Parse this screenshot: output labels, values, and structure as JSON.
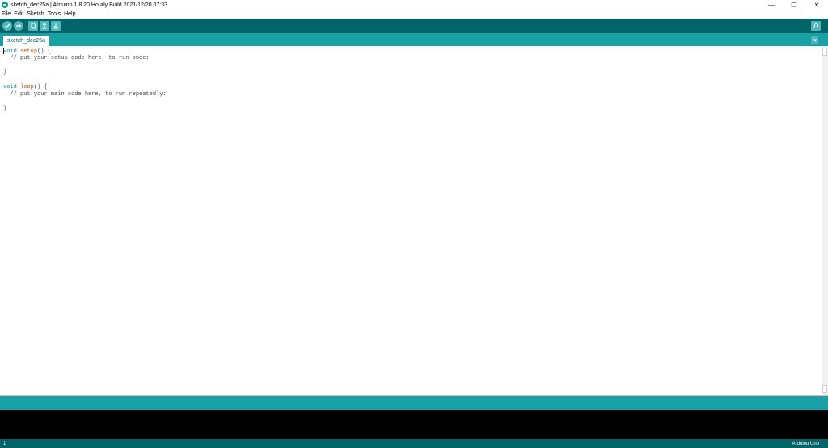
{
  "window": {
    "title": "sketch_dec25a | Arduino 1.8.20 Hourly Build 2021/12/20 07:33",
    "minimize_glyph": "—",
    "restore_glyph": "❐",
    "close_glyph": "✕"
  },
  "menu": {
    "items": [
      {
        "label": "File"
      },
      {
        "label": "Edit"
      },
      {
        "label": "Sketch"
      },
      {
        "label": "Tools"
      },
      {
        "label": "Help"
      }
    ]
  },
  "toolbar": {
    "buttons": [
      "verify-icon",
      "upload-icon",
      "new-icon",
      "open-icon",
      "save-icon"
    ],
    "serial_monitor_icon": "magnifier-icon"
  },
  "tabs": [
    {
      "label": "sketch_dec25a",
      "active": true
    }
  ],
  "editor": {
    "lines": [
      {
        "t1": "void",
        "t2": " ",
        "t3": "setup",
        "t4": "() {"
      },
      {
        "t1": "",
        "t2": "  // put your setup code here, to run once:",
        "t3": "",
        "t4": ""
      },
      {
        "t1": "",
        "t2": "",
        "t3": "",
        "t4": ""
      },
      {
        "t1": "",
        "t2": "}",
        "t3": "",
        "t4": ""
      },
      {
        "t1": "",
        "t2": "",
        "t3": "",
        "t4": ""
      },
      {
        "t1": "void",
        "t2": " ",
        "t3": "loop",
        "t4": "() {"
      },
      {
        "t1": "",
        "t2": "  // put your main code here, to run repeatedly:",
        "t3": "",
        "t4": ""
      },
      {
        "t1": "",
        "t2": "",
        "t3": "",
        "t4": ""
      },
      {
        "t1": "",
        "t2": "}",
        "t3": "",
        "t4": ""
      }
    ]
  },
  "status": {
    "line_number": "1",
    "board": "Arduino Uno"
  },
  "colors": {
    "toolbar": "#006468",
    "tabbar": "#17a1a5",
    "button": "#4db7bb",
    "keyword": "#00979c",
    "function": "#d35400",
    "console": "#000000"
  }
}
